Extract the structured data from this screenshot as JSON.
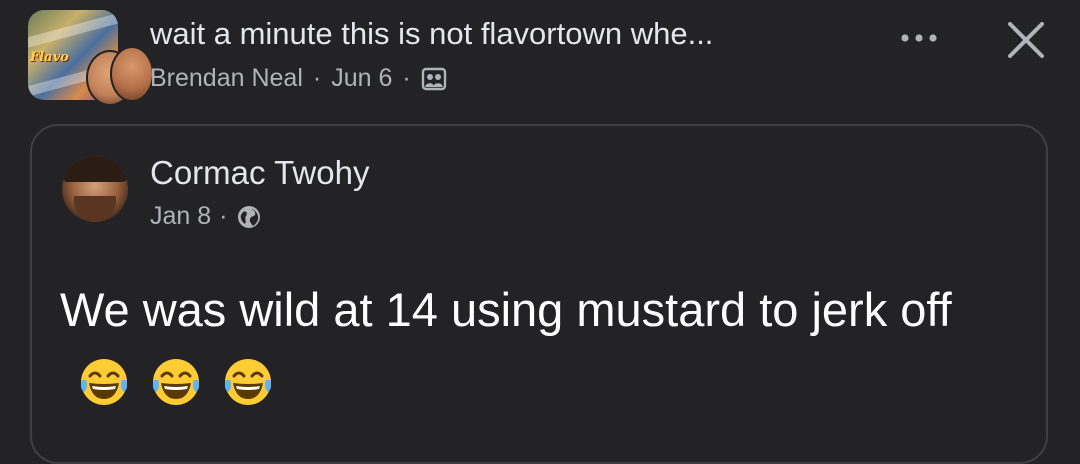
{
  "header": {
    "title": "wait a minute this is not flavortown whe...",
    "author": "Brendan Neal",
    "date": "Jun 6",
    "separator": "·",
    "group_cover_text": "Flavo",
    "more_icon": "more-horizontal-icon",
    "close_icon": "close-icon",
    "audience_icon": "members-icon"
  },
  "shared_post": {
    "author": "Cormac Twohy",
    "date": "Jan 8",
    "separator": "·",
    "privacy_icon": "globe-icon",
    "text": "We was wild at 14 using mustard to jerk off",
    "emoji": [
      "😂",
      "😂",
      "😂"
    ]
  },
  "colors": {
    "background": "#232325",
    "primary_text": "#e4e6eb",
    "secondary_text": "#b0b3b8",
    "card_border": "#3e4042",
    "emoji_yellow": "#ffcc33"
  }
}
